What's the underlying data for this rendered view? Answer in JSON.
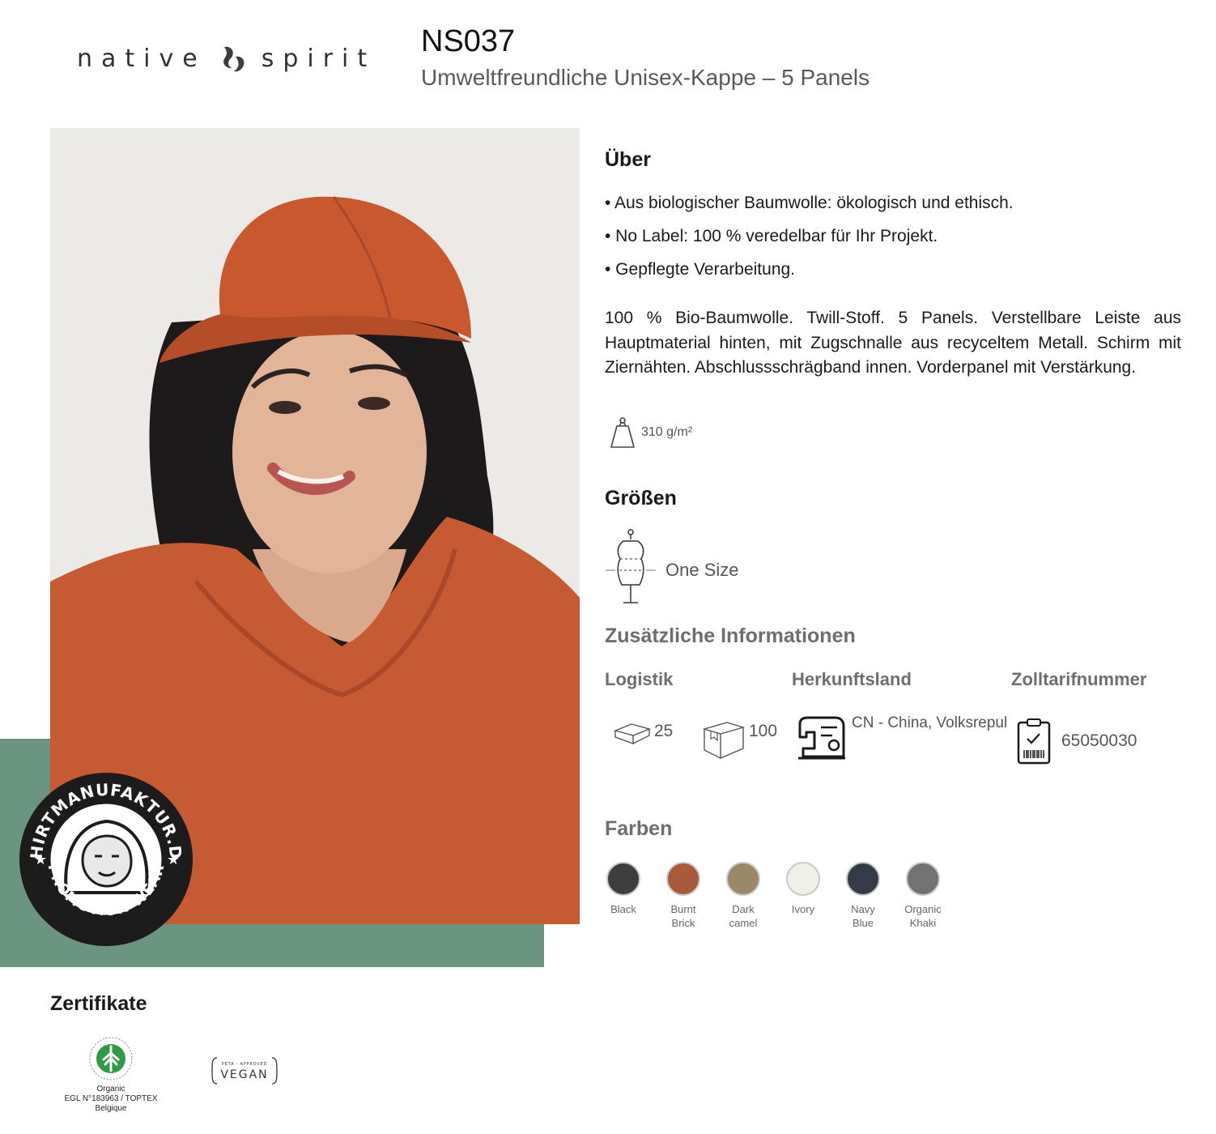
{
  "header": {
    "brand_left": "native",
    "brand_right": "spirit",
    "code": "NS037",
    "subtitle": "Umweltfreundliche Unisex-Kappe – 5 Panels"
  },
  "badge": {
    "text_top": "SHIRTMANUFAKTUR.DE",
    "text_bottom": "PROMOTION-WEAR"
  },
  "about": {
    "heading": "Über",
    "bullets": [
      "• Aus biologischer Baumwolle: ökologisch und ethisch.",
      "• No Label: 100 % veredelbar für Ihr Projekt.",
      "• Gepflegte Verarbeitung."
    ],
    "description": "100 % Bio-Baumwolle. Twill-Stoff. 5 Panels. Verstellbare Leiste aus Hauptmaterial hinten, mit Zugschnalle aus recyceltem Metall. Schirm mit Ziernähten. Abschlussschrägband innen. Vorderpanel mit Verstärkung.",
    "weight": "310 g/m²",
    "weight_icon": "weight-icon"
  },
  "sizes": {
    "heading": "Größen",
    "value": "One Size",
    "icon": "mannequin-icon"
  },
  "additional": {
    "heading": "Zusätzliche Informationen",
    "logistics_label": "Logistik",
    "origin_label": "Herkunftsland",
    "tariff_label": "Zolltarifnummer",
    "pack_small": "25",
    "pack_large": "100",
    "origin": "CN - China, Volksrepul",
    "tariff": "65050030"
  },
  "colors": {
    "heading": "Farben",
    "items": [
      {
        "line1": "Black",
        "line2": "",
        "hex": "#3d3e40"
      },
      {
        "line1": "Burnt",
        "line2": "Brick",
        "hex": "#a85a3a"
      },
      {
        "line1": "Dark",
        "line2": "camel",
        "hex": "#9c8866"
      },
      {
        "line1": "Ivory",
        "line2": "",
        "hex": "#f0efe8"
      },
      {
        "line1": "Navy",
        "line2": "Blue",
        "hex": "#343a48"
      },
      {
        "line1": "Organic",
        "line2": "Khaki",
        "hex": "#727370"
      }
    ]
  },
  "certificates": {
    "heading": "Zertifikate",
    "gots_caption_1": "Organic",
    "gots_caption_2": "EGL N°183963 / TOPTEX Belgique",
    "vegan_top": "PETA · APPROVED",
    "vegan_label": "VEGAN"
  },
  "theme": {
    "green": "#6a9580",
    "product_orange": "#c9582f"
  }
}
